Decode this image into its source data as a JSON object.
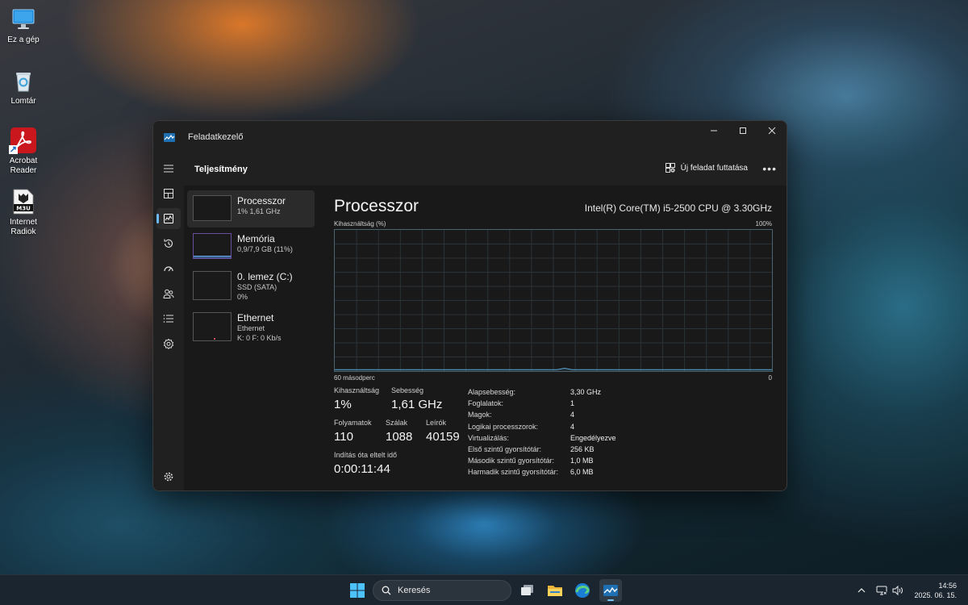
{
  "desktop": {
    "icons": [
      {
        "label": "Ez a gép",
        "icon": "monitor-icon"
      },
      {
        "label": "Lomtár",
        "icon": "recycle-bin-icon"
      },
      {
        "label": "Acrobat Reader",
        "icon": "acrobat-icon"
      },
      {
        "label": "Internet Radiok",
        "icon": "m3u-file-icon",
        "badge": "M3U"
      }
    ]
  },
  "window": {
    "title": "Feladatkezelő",
    "page_title": "Teljesítmény",
    "run_task_label": "Új feladat futtatása",
    "more_label": "•••",
    "sidebar_items": [
      {
        "name": "Processzor",
        "sub1": "1% 1,61 GHz",
        "sub2": ""
      },
      {
        "name": "Memória",
        "sub1": "0,9/7,9 GB (11%)",
        "sub2": ""
      },
      {
        "name": "0. lemez (C:)",
        "sub1": "SSD (SATA)",
        "sub2": "0%"
      },
      {
        "name": "Ethernet",
        "sub1": "Ethernet",
        "sub2": "K: 0 F: 0 Kb/s"
      }
    ],
    "main": {
      "title": "Processzor",
      "cpu_name": "Intel(R) Core(TM) i5-2500 CPU @ 3.30GHz",
      "graph_label_top_left": "Kihasználtság (%)",
      "graph_label_top_right": "100%",
      "graph_label_bottom_left": "60 másodperc",
      "graph_label_bottom_right": "0",
      "cpu_usage_history_percent": [
        1,
        1,
        1,
        1,
        1,
        1,
        1,
        1,
        1,
        1,
        1,
        1,
        1,
        1,
        1,
        1,
        1,
        1,
        1,
        1,
        1,
        1,
        1,
        1,
        1,
        1,
        1,
        1,
        1,
        1,
        1,
        2,
        1,
        1,
        1,
        1,
        1,
        1,
        1,
        1,
        1,
        1,
        1,
        1,
        1,
        1,
        1,
        1,
        1,
        1,
        1,
        1,
        1,
        1,
        1,
        1,
        1,
        1,
        1,
        1
      ],
      "stats": {
        "usage_label": "Kihasználtság",
        "usage_value": "1%",
        "speed_label": "Sebesség",
        "speed_value": "1,61 GHz",
        "processes_label": "Folyamatok",
        "processes_value": "110",
        "threads_label": "Szálak",
        "threads_value": "1088",
        "handles_label": "Leírók",
        "handles_value": "40159",
        "uptime_label": "Indítás óta eltelt idő",
        "uptime_value": "0:00:11:44"
      },
      "details": [
        {
          "k": "Alapsebesség:",
          "v": "3,30 GHz"
        },
        {
          "k": "Foglalatok:",
          "v": "1"
        },
        {
          "k": "Magok:",
          "v": "4"
        },
        {
          "k": "Logikai processzorok:",
          "v": "4"
        },
        {
          "k": "Virtualizálás:",
          "v": "Engedélyezve"
        },
        {
          "k": "Első szintű gyorsítótár:",
          "v": "256 KB"
        },
        {
          "k": "Második szintű gyorsítótár:",
          "v": "1,0 MB"
        },
        {
          "k": "Harmadik szintű gyorsítótár:",
          "v": "6,0 MB"
        }
      ]
    }
  },
  "taskbar": {
    "search_placeholder": "Keresés",
    "time": "14:56",
    "date": "2025. 06. 15."
  },
  "colors": {
    "accent": "#6cb8f0",
    "graph_line": "#5aa9d6",
    "window_bg": "#1c1c1c"
  }
}
